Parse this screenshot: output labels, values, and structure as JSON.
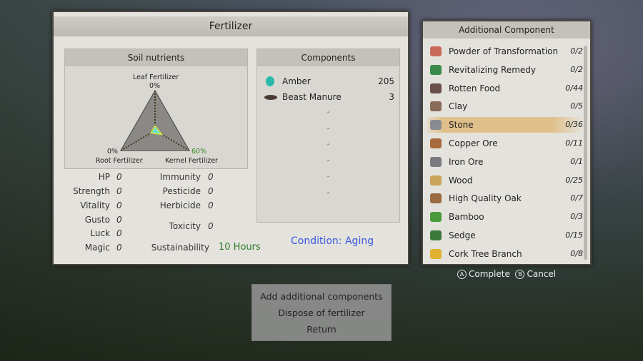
{
  "fertilizer": {
    "title": "Fertilizer",
    "soil": {
      "title": "Soil nutrients",
      "leaf_label": "Leaf Fertilizer",
      "leaf_value": "0%",
      "root_label": "Root Fertilizer",
      "root_value": "0%",
      "kernel_label": "Kernel Fertilizer",
      "kernel_value": "60%",
      "leaf_pct": 0,
      "root_pct": 0,
      "kernel_pct": 60
    },
    "stats_left": [
      {
        "label": "HP",
        "value": "0"
      },
      {
        "label": "Strength",
        "value": "0"
      },
      {
        "label": "Vitality",
        "value": "0"
      },
      {
        "label": "Gusto",
        "value": "0"
      },
      {
        "label": "Luck",
        "value": "0"
      },
      {
        "label": "Magic",
        "value": "0"
      }
    ],
    "stats_right": [
      {
        "label": "Immunity",
        "value": "0"
      },
      {
        "label": "Pesticide",
        "value": "0"
      },
      {
        "label": "Herbicide",
        "value": "0"
      },
      {
        "label": "Toxicity",
        "value": "0"
      }
    ],
    "sustainability": {
      "label": "Sustainability",
      "value": "10 Hours"
    },
    "components": {
      "title": "Components",
      "items": [
        {
          "name": "Amber",
          "count": "205"
        },
        {
          "name": "Beast Manure",
          "count": "3"
        }
      ],
      "empty": "-"
    },
    "condition": "Condition: Aging"
  },
  "additional": {
    "title": "Additional Component",
    "items": [
      {
        "name": "Powder of Transformation",
        "count": "0/2",
        "color": "#c86a5a"
      },
      {
        "name": "Revitalizing Remedy",
        "count": "0/2",
        "color": "#3a8a4a"
      },
      {
        "name": "Rotten Food",
        "count": "0/44",
        "color": "#6a5048"
      },
      {
        "name": "Clay",
        "count": "0/5",
        "color": "#8a6a58"
      },
      {
        "name": "Stone",
        "count": "0/36",
        "color": "#8a8a92"
      },
      {
        "name": "Copper Ore",
        "count": "0/11",
        "color": "#a86a3a"
      },
      {
        "name": "Iron Ore",
        "count": "0/1",
        "color": "#7a7a80"
      },
      {
        "name": "Wood",
        "count": "0/25",
        "color": "#c8a45a"
      },
      {
        "name": "High Quality Oak",
        "count": "0/7",
        "color": "#9a6a40"
      },
      {
        "name": "Bamboo",
        "count": "0/3",
        "color": "#4a9a3a"
      },
      {
        "name": "Sedge",
        "count": "0/15",
        "color": "#3a7a3a"
      },
      {
        "name": "Cork Tree Branch",
        "count": "0/8",
        "color": "#e0b030"
      }
    ],
    "selected": "Stone"
  },
  "hints": {
    "a_glyph": "A",
    "complete": "Complete",
    "b_glyph": "B",
    "cancel": "Cancel"
  },
  "menu": [
    "Add additional components",
    "Dispose of fertilizer",
    "Return"
  ]
}
